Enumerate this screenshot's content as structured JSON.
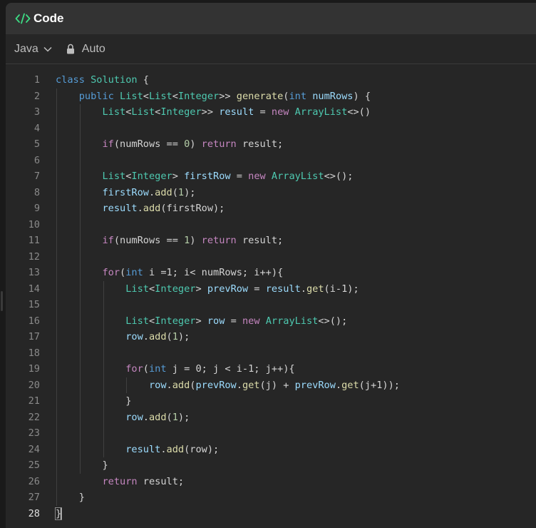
{
  "header": {
    "title": "Code",
    "icon": "code-brackets-icon",
    "accent": "#3ddc84"
  },
  "toolbar": {
    "language": "Java",
    "mode": "Auto"
  },
  "editor": {
    "active_line": 28,
    "lines": [
      {
        "n": "1",
        "tokens": [
          {
            "t": "class ",
            "c": "kw"
          },
          {
            "t": "Solution ",
            "c": "ty"
          },
          {
            "t": "{",
            "c": "pl"
          }
        ]
      },
      {
        "n": "2",
        "tokens": [
          {
            "t": "    "
          },
          {
            "t": "public ",
            "c": "kw"
          },
          {
            "t": "List",
            "c": "ty"
          },
          {
            "t": "<",
            "c": "pl"
          },
          {
            "t": "List",
            "c": "ty"
          },
          {
            "t": "<",
            "c": "pl"
          },
          {
            "t": "Integer",
            "c": "ty"
          },
          {
            "t": ">> ",
            "c": "pl"
          },
          {
            "t": "generate",
            "c": "fn"
          },
          {
            "t": "(",
            "c": "pl"
          },
          {
            "t": "int ",
            "c": "kw"
          },
          {
            "t": "numRows",
            "c": "vr"
          },
          {
            "t": ") {",
            "c": "pl"
          }
        ]
      },
      {
        "n": "3",
        "tokens": [
          {
            "t": "        "
          },
          {
            "t": "List",
            "c": "ty"
          },
          {
            "t": "<",
            "c": "pl"
          },
          {
            "t": "List",
            "c": "ty"
          },
          {
            "t": "<",
            "c": "pl"
          },
          {
            "t": "Integer",
            "c": "ty"
          },
          {
            "t": ">> ",
            "c": "pl"
          },
          {
            "t": "result",
            "c": "vr"
          },
          {
            "t": " = ",
            "c": "pl"
          },
          {
            "t": "new ",
            "c": "cf"
          },
          {
            "t": "ArrayList",
            "c": "ty"
          },
          {
            "t": "<>()",
            "c": "pl"
          }
        ]
      },
      {
        "n": "4",
        "tokens": []
      },
      {
        "n": "5",
        "tokens": [
          {
            "t": "        "
          },
          {
            "t": "if",
            "c": "cf"
          },
          {
            "t": "(numRows == ",
            "c": "pl"
          },
          {
            "t": "0",
            "c": "nm"
          },
          {
            "t": ") ",
            "c": "pl"
          },
          {
            "t": "return ",
            "c": "cf"
          },
          {
            "t": "result;",
            "c": "pl"
          }
        ]
      },
      {
        "n": "6",
        "tokens": []
      },
      {
        "n": "7",
        "tokens": [
          {
            "t": "        "
          },
          {
            "t": "List",
            "c": "ty"
          },
          {
            "t": "<",
            "c": "pl"
          },
          {
            "t": "Integer",
            "c": "ty"
          },
          {
            "t": "> ",
            "c": "pl"
          },
          {
            "t": "firstRow",
            "c": "vr"
          },
          {
            "t": " = ",
            "c": "pl"
          },
          {
            "t": "new ",
            "c": "cf"
          },
          {
            "t": "ArrayList",
            "c": "ty"
          },
          {
            "t": "<>();",
            "c": "pl"
          }
        ]
      },
      {
        "n": "8",
        "tokens": [
          {
            "t": "        "
          },
          {
            "t": "firstRow",
            "c": "vr"
          },
          {
            "t": ".",
            "c": "pl"
          },
          {
            "t": "add",
            "c": "fn"
          },
          {
            "t": "(",
            "c": "pl"
          },
          {
            "t": "1",
            "c": "nm"
          },
          {
            "t": ");",
            "c": "pl"
          }
        ]
      },
      {
        "n": "9",
        "tokens": [
          {
            "t": "        "
          },
          {
            "t": "result",
            "c": "vr"
          },
          {
            "t": ".",
            "c": "pl"
          },
          {
            "t": "add",
            "c": "fn"
          },
          {
            "t": "(firstRow);",
            "c": "pl"
          }
        ]
      },
      {
        "n": "10",
        "tokens": []
      },
      {
        "n": "11",
        "tokens": [
          {
            "t": "        "
          },
          {
            "t": "if",
            "c": "cf"
          },
          {
            "t": "(numRows == ",
            "c": "pl"
          },
          {
            "t": "1",
            "c": "nm"
          },
          {
            "t": ") ",
            "c": "pl"
          },
          {
            "t": "return ",
            "c": "cf"
          },
          {
            "t": "result;",
            "c": "pl"
          }
        ]
      },
      {
        "n": "12",
        "tokens": []
      },
      {
        "n": "13",
        "tokens": [
          {
            "t": "        "
          },
          {
            "t": "for",
            "c": "cf"
          },
          {
            "t": "(",
            "c": "pl"
          },
          {
            "t": "int ",
            "c": "kw"
          },
          {
            "t": "i =1; i< numRows; i++){",
            "c": "pl"
          }
        ]
      },
      {
        "n": "14",
        "tokens": [
          {
            "t": "            "
          },
          {
            "t": "List",
            "c": "ty"
          },
          {
            "t": "<",
            "c": "pl"
          },
          {
            "t": "Integer",
            "c": "ty"
          },
          {
            "t": "> ",
            "c": "pl"
          },
          {
            "t": "prevRow",
            "c": "vr"
          },
          {
            "t": " = ",
            "c": "pl"
          },
          {
            "t": "result",
            "c": "vr"
          },
          {
            "t": ".",
            "c": "pl"
          },
          {
            "t": "get",
            "c": "fn"
          },
          {
            "t": "(i-1);",
            "c": "pl"
          }
        ]
      },
      {
        "n": "15",
        "tokens": []
      },
      {
        "n": "16",
        "tokens": [
          {
            "t": "            "
          },
          {
            "t": "List",
            "c": "ty"
          },
          {
            "t": "<",
            "c": "pl"
          },
          {
            "t": "Integer",
            "c": "ty"
          },
          {
            "t": "> ",
            "c": "pl"
          },
          {
            "t": "row",
            "c": "vr"
          },
          {
            "t": " = ",
            "c": "pl"
          },
          {
            "t": "new ",
            "c": "cf"
          },
          {
            "t": "ArrayList",
            "c": "ty"
          },
          {
            "t": "<>();",
            "c": "pl"
          }
        ]
      },
      {
        "n": "17",
        "tokens": [
          {
            "t": "            "
          },
          {
            "t": "row",
            "c": "vr"
          },
          {
            "t": ".",
            "c": "pl"
          },
          {
            "t": "add",
            "c": "fn"
          },
          {
            "t": "(",
            "c": "pl"
          },
          {
            "t": "1",
            "c": "nm"
          },
          {
            "t": ");",
            "c": "pl"
          }
        ]
      },
      {
        "n": "18",
        "tokens": []
      },
      {
        "n": "19",
        "tokens": [
          {
            "t": "            "
          },
          {
            "t": "for",
            "c": "cf"
          },
          {
            "t": "(",
            "c": "pl"
          },
          {
            "t": "int ",
            "c": "kw"
          },
          {
            "t": "j = 0; j < i-1; j++){",
            "c": "pl"
          }
        ]
      },
      {
        "n": "20",
        "tokens": [
          {
            "t": "                "
          },
          {
            "t": "row",
            "c": "vr"
          },
          {
            "t": ".",
            "c": "pl"
          },
          {
            "t": "add",
            "c": "fn"
          },
          {
            "t": "(",
            "c": "pl"
          },
          {
            "t": "prevRow",
            "c": "vr"
          },
          {
            "t": ".",
            "c": "pl"
          },
          {
            "t": "get",
            "c": "fn"
          },
          {
            "t": "(j) + ",
            "c": "pl"
          },
          {
            "t": "prevRow",
            "c": "vr"
          },
          {
            "t": ".",
            "c": "pl"
          },
          {
            "t": "get",
            "c": "fn"
          },
          {
            "t": "(j+1));",
            "c": "pl"
          }
        ]
      },
      {
        "n": "21",
        "tokens": [
          {
            "t": "            "
          },
          {
            "t": "}",
            "c": "pl"
          }
        ]
      },
      {
        "n": "22",
        "tokens": [
          {
            "t": "            "
          },
          {
            "t": "row",
            "c": "vr"
          },
          {
            "t": ".",
            "c": "pl"
          },
          {
            "t": "add",
            "c": "fn"
          },
          {
            "t": "(",
            "c": "pl"
          },
          {
            "t": "1",
            "c": "nm"
          },
          {
            "t": ");",
            "c": "pl"
          }
        ]
      },
      {
        "n": "23",
        "tokens": []
      },
      {
        "n": "24",
        "tokens": [
          {
            "t": "            "
          },
          {
            "t": "result",
            "c": "vr"
          },
          {
            "t": ".",
            "c": "pl"
          },
          {
            "t": "add",
            "c": "fn"
          },
          {
            "t": "(row);",
            "c": "pl"
          }
        ]
      },
      {
        "n": "25",
        "tokens": [
          {
            "t": "        "
          },
          {
            "t": "}",
            "c": "pl"
          }
        ]
      },
      {
        "n": "26",
        "tokens": [
          {
            "t": "        "
          },
          {
            "t": "return ",
            "c": "cf"
          },
          {
            "t": "result;",
            "c": "pl"
          }
        ]
      },
      {
        "n": "27",
        "tokens": [
          {
            "t": "    "
          },
          {
            "t": "}",
            "c": "pl"
          }
        ]
      },
      {
        "n": "28",
        "tokens": [
          {
            "t": "}",
            "c": "pl",
            "mark": true
          }
        ]
      }
    ]
  }
}
